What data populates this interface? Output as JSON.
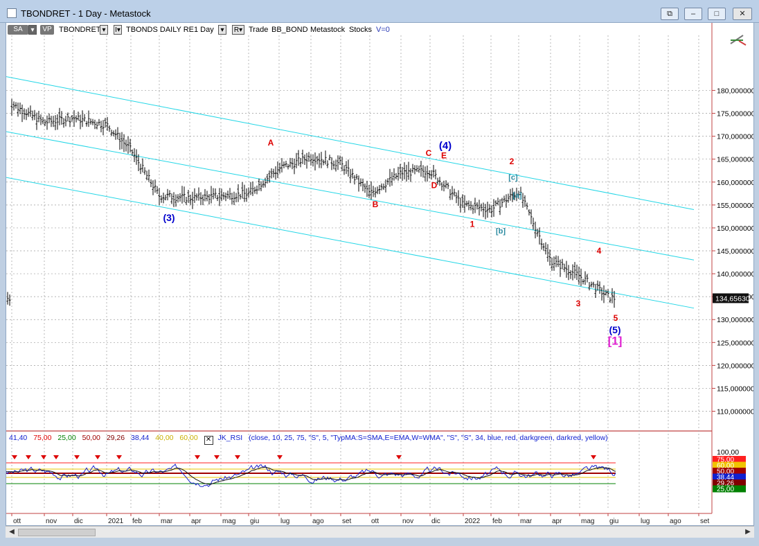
{
  "window": {
    "title": "TBONDRET - 1 Day - Metastock",
    "btn_restore_ext": "⧉",
    "btn_min": "–",
    "btn_max": "□",
    "btn_close": "✕"
  },
  "toolbar": {
    "sa": "SA",
    "vp": "VP",
    "symbol": "TBONDRET",
    "name": "TBONDS DAILY RE",
    "period": "1 Day",
    "r": "R▾",
    "trade": "Trade",
    "bb": "BB_BOND",
    "ms": "Metastock",
    "stocks": "Stocks",
    "v": "V=0"
  },
  "rsi_legend": {
    "v1": "41,40",
    "v2": "75,00",
    "v3": "25,00",
    "v4": "50,00",
    "v5": "29,26",
    "v6": "38,44",
    "v7": "40,00",
    "v8": "60,00",
    "name": "JK_RSI",
    "params": "(close,  10,  25,  75,  \"S\",  5,  \"TypMA:S=SMA,E=EMA,W=WMA\",  \"S\",  \"S\",  34,  blue,  red,  darkgreen,  darkred,  yellow)"
  },
  "rsi_axis": {
    "top": "100,00",
    "tags": [
      {
        "text": "75,00",
        "bg": "#ff2020"
      },
      {
        "text": "60,00",
        "bg": "#f0c400"
      },
      {
        "text": "50,00",
        "bg": "#a00000"
      },
      {
        "text": "38,44",
        "bg": "#1020d0"
      },
      {
        "text": "29,26",
        "bg": "#800000"
      },
      {
        "text": "25,00",
        "bg": "#008000"
      }
    ]
  },
  "chart_data": {
    "type": "candlestick-ohlc",
    "symbol": "TBONDRET",
    "x_ticks": [
      "ott",
      "nov",
      "dic",
      "2021",
      "feb",
      "mar",
      "apr",
      "mag",
      "giu",
      "lug",
      "ago",
      "set",
      "ott",
      "nov",
      "dic",
      "2022",
      "feb",
      "mar",
      "apr",
      "mag",
      "giu",
      "lug",
      "ago",
      "set"
    ],
    "y_ticks": [
      "180,000000",
      "175,000000",
      "170,000000",
      "165,000000",
      "160,000000",
      "155,000000",
      "150,000000",
      "145,000000",
      "140,000000",
      "135,000000",
      "130,000000",
      "125,000000",
      "120,000000",
      "115,000000",
      "110,000000"
    ],
    "ylim": [
      106.3,
      190.5
    ],
    "last_price": "134,65630",
    "close_path": [
      [
        "ott",
        177
      ],
      [
        "nov",
        173
      ],
      [
        "dic",
        174
      ],
      [
        "2021",
        172.5
      ],
      [
        "feb",
        167
      ],
      [
        "mar",
        157
      ],
      [
        "apr",
        156.5
      ],
      [
        "mag",
        157
      ],
      [
        "giu",
        157.5
      ],
      [
        "lug",
        163
      ],
      [
        "ago",
        165.5
      ],
      [
        "set",
        164
      ],
      [
        "ott",
        157.5
      ],
      [
        "nov",
        162
      ],
      [
        "dic",
        162.5
      ],
      [
        "2022",
        155
      ],
      [
        "feb",
        154
      ],
      [
        "mar",
        158
      ],
      [
        "apr",
        143
      ],
      [
        "mag",
        139.5
      ],
      [
        "giu",
        135
      ],
      [
        "giu_end",
        134.6563
      ]
    ],
    "channel_lines": [
      {
        "from": [
          "ott",
          183
        ],
        "to": [
          "set",
          154
        ]
      },
      {
        "from": [
          "ott",
          171
        ],
        "to": [
          "set",
          143
        ]
      },
      {
        "from": [
          "ott",
          161
        ],
        "to": [
          "set",
          132.5
        ]
      }
    ],
    "wave_labels": [
      {
        "text": "(3)",
        "x": "mar",
        "y": 151.5,
        "color": "#0000cc",
        "size": 14
      },
      {
        "text": "A",
        "x": "lug",
        "y": 168,
        "color": "#dd0000",
        "size": 12
      },
      {
        "text": "B",
        "x": "ott",
        "y": 154.5,
        "color": "#dd0000",
        "size": 12
      },
      {
        "text": "C",
        "x": "dic",
        "y": 165.7,
        "color": "#dd0000",
        "size": 12
      },
      {
        "text": "D",
        "x": "dic",
        "y": 158.7,
        "color": "#dd0000",
        "size": 12
      },
      {
        "text": "E",
        "x": "dic",
        "y": 165.2,
        "color": "#dd0000",
        "size": 12
      },
      {
        "text": "(4)",
        "x": "dic",
        "y": 167.2,
        "color": "#0000cc",
        "size": 15
      },
      {
        "text": "1",
        "x": "2022",
        "y": 150.2,
        "color": "#dd0000",
        "size": 12
      },
      {
        "text": "[a]",
        "x": "feb",
        "y": 156.6,
        "color": "#2a8aa0",
        "size": 11
      },
      {
        "text": "[b]",
        "x": "feb",
        "y": 148.8,
        "color": "#2a8aa0",
        "size": 11
      },
      {
        "text": "[c]",
        "x": "mar",
        "y": 160.5,
        "color": "#2a8aa0",
        "size": 11
      },
      {
        "text": "2",
        "x": "mar",
        "y": 163.9,
        "color": "#dd0000",
        "size": 12
      },
      {
        "text": "3",
        "x": "mag",
        "y": 132.9,
        "color": "#dd0000",
        "size": 12
      },
      {
        "text": "4",
        "x": "mag",
        "y": 144.4,
        "color": "#dd0000",
        "size": 12
      },
      {
        "text": "5",
        "x": "giu",
        "y": 129.7,
        "color": "#dd0000",
        "size": 12
      },
      {
        "text": "(5)",
        "x": "giu",
        "y": 127,
        "color": "#0000cc",
        "size": 14
      },
      {
        "text": "[1]",
        "x": "giu",
        "y": 124.5,
        "color": "#e020d0",
        "size": 17
      }
    ],
    "grid": true
  },
  "rsi_markers": [
    "nov",
    "nov",
    "nov",
    "dic",
    "dic",
    "2021",
    "feb",
    "apr",
    "mag",
    "giu",
    "lug",
    "nov",
    "giu"
  ]
}
